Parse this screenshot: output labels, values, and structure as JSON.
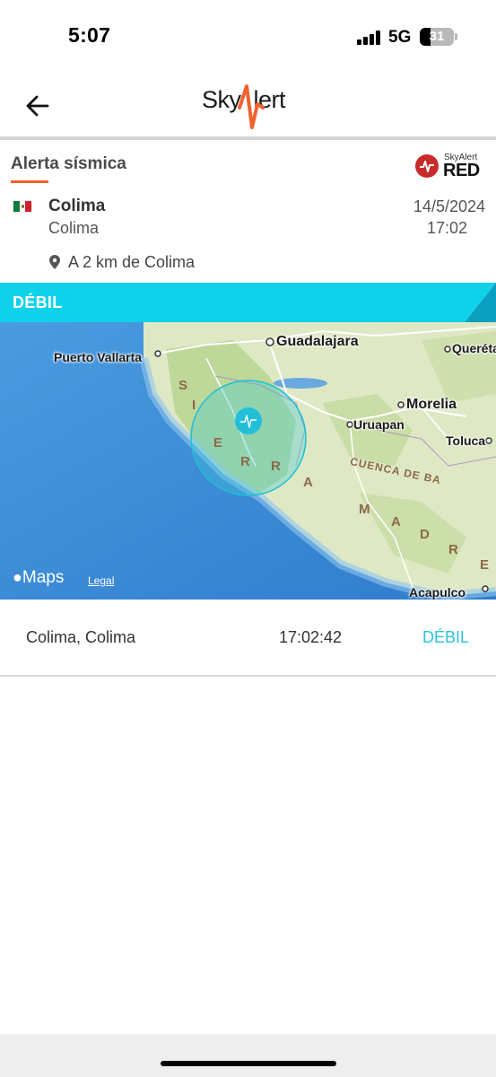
{
  "status_bar": {
    "time": "5:07",
    "network": "5G",
    "battery": "31",
    "battery_level": 0.31
  },
  "header": {
    "back_icon": "arrow-left-icon",
    "logo_text_left": "Sky",
    "logo_text_right": "lert",
    "logo_accent_color": "#f2622e"
  },
  "alert": {
    "title": "Alerta sísmica",
    "badge_small": "SkyAlert",
    "badge_big": "RED",
    "country_flag_icon": "mexico-flag-icon",
    "city": "Colima",
    "state": "Colima",
    "date": "14/5/2024",
    "time": "17:02",
    "distance": "A 2 km de Colima",
    "intensity": "DÉBIL",
    "intensity_color": "#0fd2ea"
  },
  "map": {
    "labels": {
      "guadalajara": "Guadalajara",
      "puerto_vallarta": "Puerto Vallarta",
      "queretaro": "Queréta",
      "morelia": "Morelia",
      "uruapan": "Uruapan",
      "toluca": "Toluca",
      "acapulco": "Acapulco",
      "sierra_s": "S",
      "sierra_i": "I",
      "sierra_e": "E",
      "sierra_r1": "R",
      "sierra_r2": "R",
      "sierra_a": "A",
      "madre_m": "M",
      "madre_a": "A",
      "madre_d": "D",
      "madre_r": "R",
      "madre_e": "E",
      "cuenca": "CUENCA DE BA"
    },
    "brand": "Maps",
    "legal": "Legal"
  },
  "results": [
    {
      "location": "Colima, Colima",
      "time": "17:02:42",
      "intensity": "DÉBIL"
    }
  ]
}
